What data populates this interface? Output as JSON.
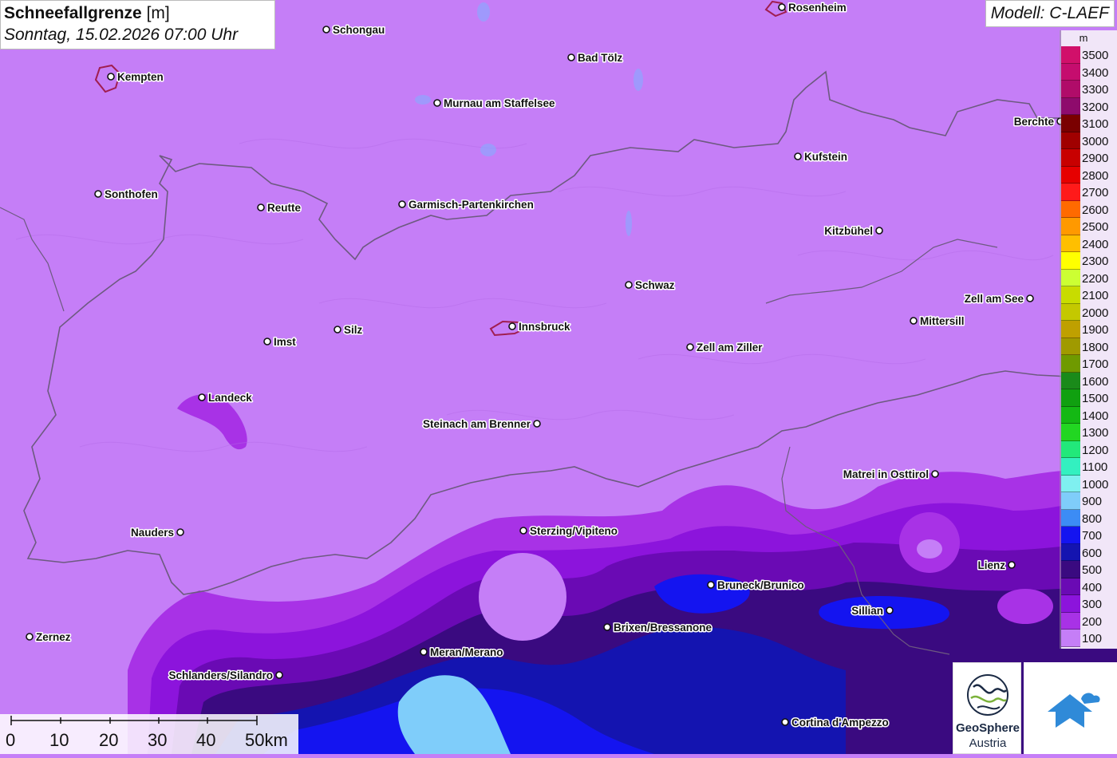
{
  "header": {
    "title": "Schneefallgrenze",
    "unit": "[m]",
    "datetime": "Sonntag, 15.02.2026 07:00 Uhr"
  },
  "model": "Modell: C-LAEF",
  "legend": {
    "unit": "m",
    "items": [
      {
        "label": "3500",
        "color": "#d1106a"
      },
      {
        "label": "3400",
        "color": "#c50d6e"
      },
      {
        "label": "3300",
        "color": "#b00c69"
      },
      {
        "label": "3200",
        "color": "#8e0b6c"
      },
      {
        "label": "3100",
        "color": "#7a0000"
      },
      {
        "label": "3000",
        "color": "#a00000"
      },
      {
        "label": "2900",
        "color": "#c80000"
      },
      {
        "label": "2800",
        "color": "#e60000"
      },
      {
        "label": "2700",
        "color": "#ff1a1a"
      },
      {
        "label": "2600",
        "color": "#ff6a00"
      },
      {
        "label": "2500",
        "color": "#ff9900"
      },
      {
        "label": "2400",
        "color": "#ffbf00"
      },
      {
        "label": "2300",
        "color": "#ffff00"
      },
      {
        "label": "2200",
        "color": "#ccff33"
      },
      {
        "label": "2100",
        "color": "#c8dc00"
      },
      {
        "label": "2000",
        "color": "#c4c800"
      },
      {
        "label": "1900",
        "color": "#bfa000"
      },
      {
        "label": "1800",
        "color": "#a09a00"
      },
      {
        "label": "1700",
        "color": "#6f9a00"
      },
      {
        "label": "1600",
        "color": "#1a8a1a"
      },
      {
        "label": "1500",
        "color": "#10a010"
      },
      {
        "label": "1400",
        "color": "#14b814"
      },
      {
        "label": "1300",
        "color": "#22d622"
      },
      {
        "label": "1200",
        "color": "#22e87a"
      },
      {
        "label": "1100",
        "color": "#33f0c0"
      },
      {
        "label": "1000",
        "color": "#7ff0f0"
      },
      {
        "label": "900",
        "color": "#7fcdfa"
      },
      {
        "label": "800",
        "color": "#3c8cf5"
      },
      {
        "label": "700",
        "color": "#1414f0"
      },
      {
        "label": "600",
        "color": "#1414b0"
      },
      {
        "label": "500",
        "color": "#3a0a80"
      },
      {
        "label": "400",
        "color": "#6a0ab4"
      },
      {
        "label": "300",
        "color": "#8c14dc"
      },
      {
        "label": "200",
        "color": "#a832e6"
      },
      {
        "label": "100",
        "color": "#c57ef7"
      }
    ]
  },
  "cities": [
    {
      "name": "Rosenheim"
    },
    {
      "name": "Schongau"
    },
    {
      "name": "Kempten"
    },
    {
      "name": "Bad Tölz"
    },
    {
      "name": "Murnau am Staffelsee"
    },
    {
      "name": "Berchte"
    },
    {
      "name": "Kufstein"
    },
    {
      "name": "Sonthofen"
    },
    {
      "name": "Reutte"
    },
    {
      "name": "Garmisch-Partenkirchen"
    },
    {
      "name": "Kitzbühel"
    },
    {
      "name": "Schwaz"
    },
    {
      "name": "Zell am See"
    },
    {
      "name": "Mittersill"
    },
    {
      "name": "Silz"
    },
    {
      "name": "Innsbruck"
    },
    {
      "name": "Imst"
    },
    {
      "name": "Zell am Ziller"
    },
    {
      "name": "Landeck"
    },
    {
      "name": "Steinach am Brenner"
    },
    {
      "name": "Matrei in Osttirol"
    },
    {
      "name": "Nauders"
    },
    {
      "name": "Sterzing/Vipiteno"
    },
    {
      "name": "Lienz"
    },
    {
      "name": "Bruneck/Brunico"
    },
    {
      "name": "Sillian"
    },
    {
      "name": "Brixen/Bressanone"
    },
    {
      "name": "Zernez"
    },
    {
      "name": "Meran/Merano"
    },
    {
      "name": "Schlanders/Silandro"
    },
    {
      "name": "Cortina d'Ampezzo"
    }
  ],
  "scalebar": {
    "labels": [
      "0",
      "10",
      "20",
      "30",
      "40",
      "50km"
    ]
  },
  "logos": {
    "geosphere_name": "GeoSphere",
    "geosphere_sub": "Austria"
  }
}
